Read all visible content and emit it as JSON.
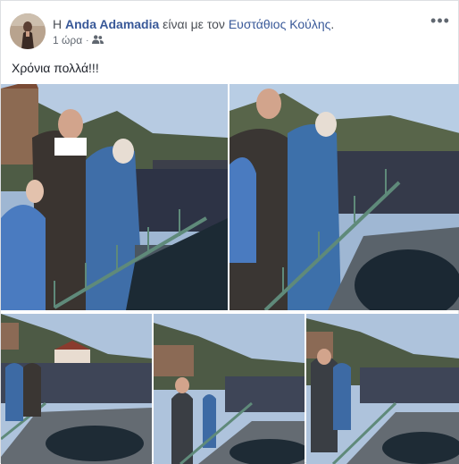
{
  "post": {
    "author_prefix": "Η ",
    "author_name": "Anda Adamadia",
    "with_text": " είναι με τον ",
    "tagged_name": "Ευστάθιος Κούλης",
    "period": ".",
    "time": "1 ώρα",
    "dot": "·",
    "privacy_icon": "friends-icon",
    "more_icon": "more-options-icon",
    "more_label": "•••",
    "text": "Χρόνια πολλά!!!"
  },
  "photos": [
    {
      "name": "photo-1"
    },
    {
      "name": "photo-2"
    },
    {
      "name": "photo-3"
    },
    {
      "name": "photo-4"
    },
    {
      "name": "photo-5"
    }
  ],
  "colors": {
    "link": "#385898",
    "muted": "#606770",
    "text": "#1d2129",
    "border": "#dddfe2"
  }
}
